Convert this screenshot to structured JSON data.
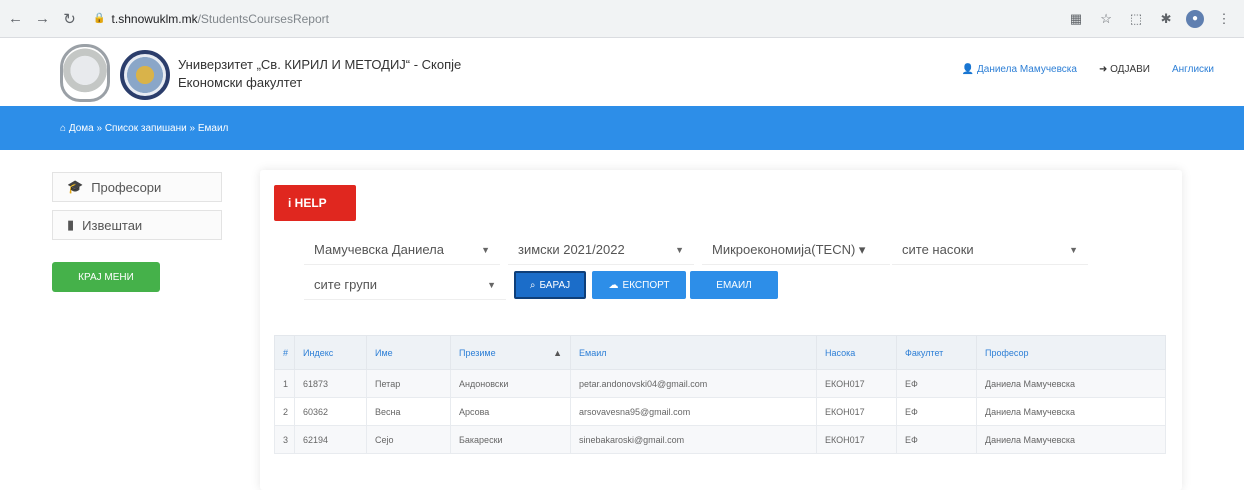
{
  "browser": {
    "url_host": "t.shnowuklm.mk",
    "url_path": "/StudentsCoursesReport"
  },
  "header": {
    "university_name": "Универзитет „Св. КИРИЛ И МЕТОДИЈ“ - Скопје",
    "faculty_name": "Економски факултет",
    "user_link": "Даниела Мамучевска",
    "logout_link": "ОДЈАВИ",
    "lang_link": "Англиски"
  },
  "breadcrumb": "Дома » Список запишани » Емаил",
  "sidebar": {
    "items": [
      {
        "icon": "graduation-cap-icon",
        "label": "Професори"
      },
      {
        "icon": "bar-chart-icon",
        "label": "Извештаи"
      }
    ],
    "button_label": "КРАЈ МЕНИ"
  },
  "panel": {
    "help_label": "HELP",
    "filters": {
      "professor": "Мамучевска Даниела",
      "semester": "зимски 2021/2022",
      "course": "Микроекономија(ТЕСN) ▾",
      "program": "сите насоки",
      "group": "сите групи"
    },
    "buttons": {
      "search": "БАРАЈ",
      "export": "ЕКСПОРТ",
      "email": "ЕМАИЛ"
    }
  },
  "table": {
    "headers": [
      "#",
      "Индекс",
      "Име",
      "Презиме",
      "Емаил",
      "Насока",
      "Факултет",
      "Професор"
    ],
    "rows": [
      [
        "1",
        "61873",
        "Петар",
        "Андоновски",
        "petar.andonovski04@gmail.com",
        "ЕКОН017",
        "ЕФ",
        "Даниела Мамучевска"
      ],
      [
        "2",
        "60362",
        "Весна",
        "Арсова",
        "arsovavesna95@gmail.com",
        "ЕКОН017",
        "ЕФ",
        "Даниела Мамучевска"
      ],
      [
        "3",
        "62194",
        "Сејо",
        "Бакарески",
        "sinebakaroski@gmail.com",
        "ЕКОН017",
        "ЕФ",
        "Даниела Мамучевска"
      ]
    ]
  },
  "colors": {
    "primary_blue": "#2d8ee8",
    "help_red": "#e0271f",
    "sidebar_green": "#45b14a"
  }
}
